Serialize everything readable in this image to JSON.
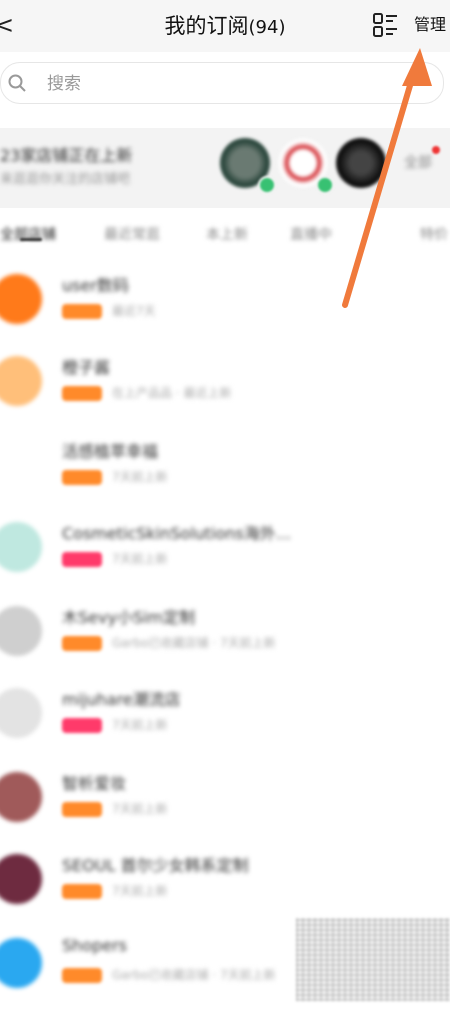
{
  "header": {
    "back_glyph": "<",
    "title": "我的订阅",
    "count": "(94)",
    "manage_label": "管理"
  },
  "search": {
    "placeholder": "搜索"
  },
  "banner": {
    "title": "23家店铺正在上新",
    "subtitle": "来逛逛你关注的店铺吧",
    "more_label": "全部"
  },
  "tabs": [
    "全部店铺",
    "最近常逛",
    "本上新",
    "直播中",
    "特价"
  ],
  "subscriptions": [
    {
      "name": "user数码",
      "meta": "最近7天",
      "badge_color": "#ff8a2a",
      "avatar_color": "#ff7a1a"
    },
    {
      "name": "橙子酱",
      "meta": "在上产品品 · 最近上新",
      "badge_color": "#ff8a2a",
      "avatar_color": "#ffbf7a"
    },
    {
      "name": "活感植萃幸福",
      "meta": "7天前上新",
      "badge_color": "#ff8a2a",
      "avatar_color": "#ffffff"
    },
    {
      "name": "CosmeticSkinSolutions海外...",
      "meta": "7天前上新",
      "badge_color": "#ff3a6a",
      "avatar_color": "#bfe8e0"
    },
    {
      "name": "木Sevy小Sim定制",
      "meta": "Garbo已收藏店铺 · 7天前上新",
      "badge_color": "#ff8a2a",
      "avatar_color": "#cfcfcf"
    },
    {
      "name": "mijuhare潮流店",
      "meta": "7天前上新",
      "badge_color": "#ff3a6a",
      "avatar_color": "#e3e3e3"
    },
    {
      "name": "智析爱妆",
      "meta": "7天前上新",
      "badge_color": "#ff8a2a",
      "avatar_color": "#a05a5a"
    },
    {
      "name": "SEOUL 首尔少女韩系定制",
      "meta": "7天前上新",
      "badge_color": "#ff8a2a",
      "avatar_color": "#6e2b40"
    },
    {
      "name": "Shopers",
      "meta": "Garbo已收藏店铺 · 7天前上新",
      "badge_color": "#ff8a2a",
      "avatar_color": "#2aa8f0"
    }
  ],
  "colors": {
    "accent_orange": "#ff8a2a",
    "accent_pink": "#ff3a6a",
    "arrow": "#f07a3c"
  }
}
